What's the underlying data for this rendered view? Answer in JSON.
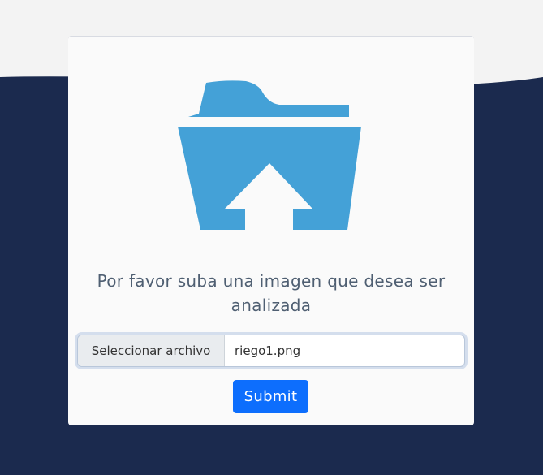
{
  "upload": {
    "icon": "folder-upload-icon",
    "prompt": "Por favor suba una imagen que desea ser analizada",
    "file_button_label": "Seleccionar archivo",
    "file_name": "riego1.png",
    "submit_label": "Submit"
  },
  "colors": {
    "background_top": "#f3f3f3",
    "background_bottom": "#1b2a4e",
    "card": "#fafafa",
    "icon": "#44a1d7",
    "submit": "#0d6efd"
  }
}
